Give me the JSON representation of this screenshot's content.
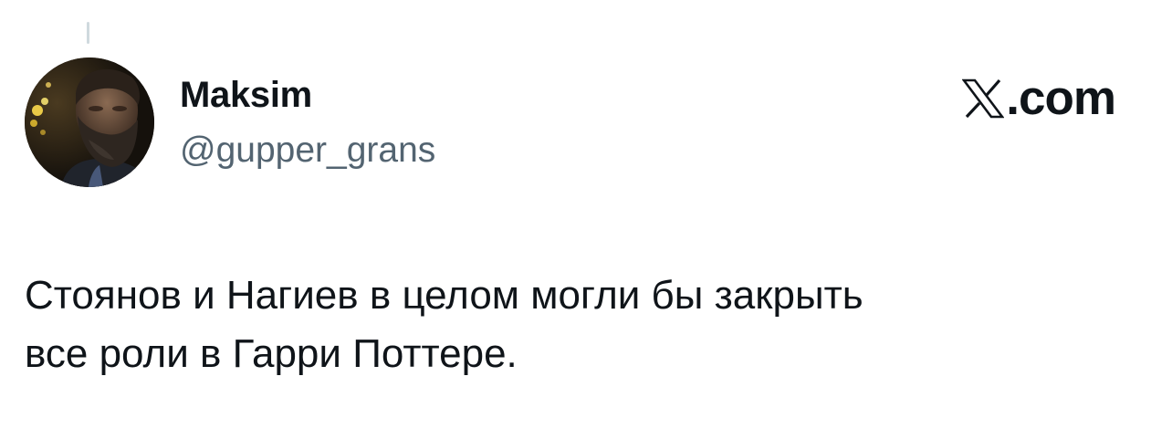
{
  "tweet": {
    "author": {
      "display_name": "Maksim",
      "handle": "@gupper_grans",
      "avatar_icon": "bearded-man-avatar"
    },
    "brand": {
      "logo_icon": "x-logo-icon",
      "domain": ".com"
    },
    "text": "Стоянов и Нагиев в целом могли бы закрыть\nвсе роли в Гарри Поттере."
  },
  "colors": {
    "text_primary": "#0f1419",
    "text_secondary": "#536471",
    "thread_line": "#cfd9de",
    "background": "#ffffff"
  }
}
